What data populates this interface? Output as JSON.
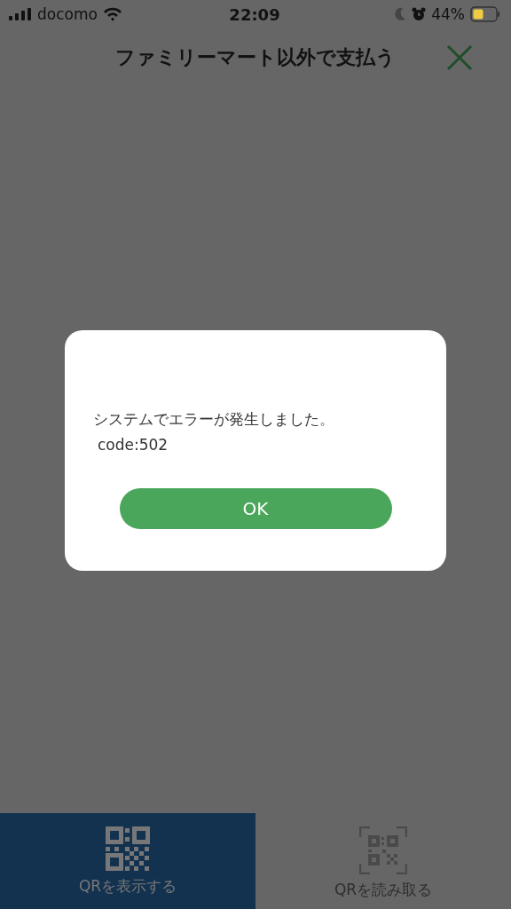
{
  "status_bar": {
    "carrier": "docomo",
    "time": "22:09",
    "battery": "44%"
  },
  "header": {
    "title": "ファミリーマート以外で支払う"
  },
  "dialog": {
    "message": "システムでエラーが発生しました。",
    "code": "code:502",
    "button": "OK"
  },
  "tabs": [
    {
      "label": "QRを表示する",
      "kind": "show",
      "selected": true
    },
    {
      "label": "QRを読み取る",
      "kind": "scan",
      "selected": false
    }
  ]
}
